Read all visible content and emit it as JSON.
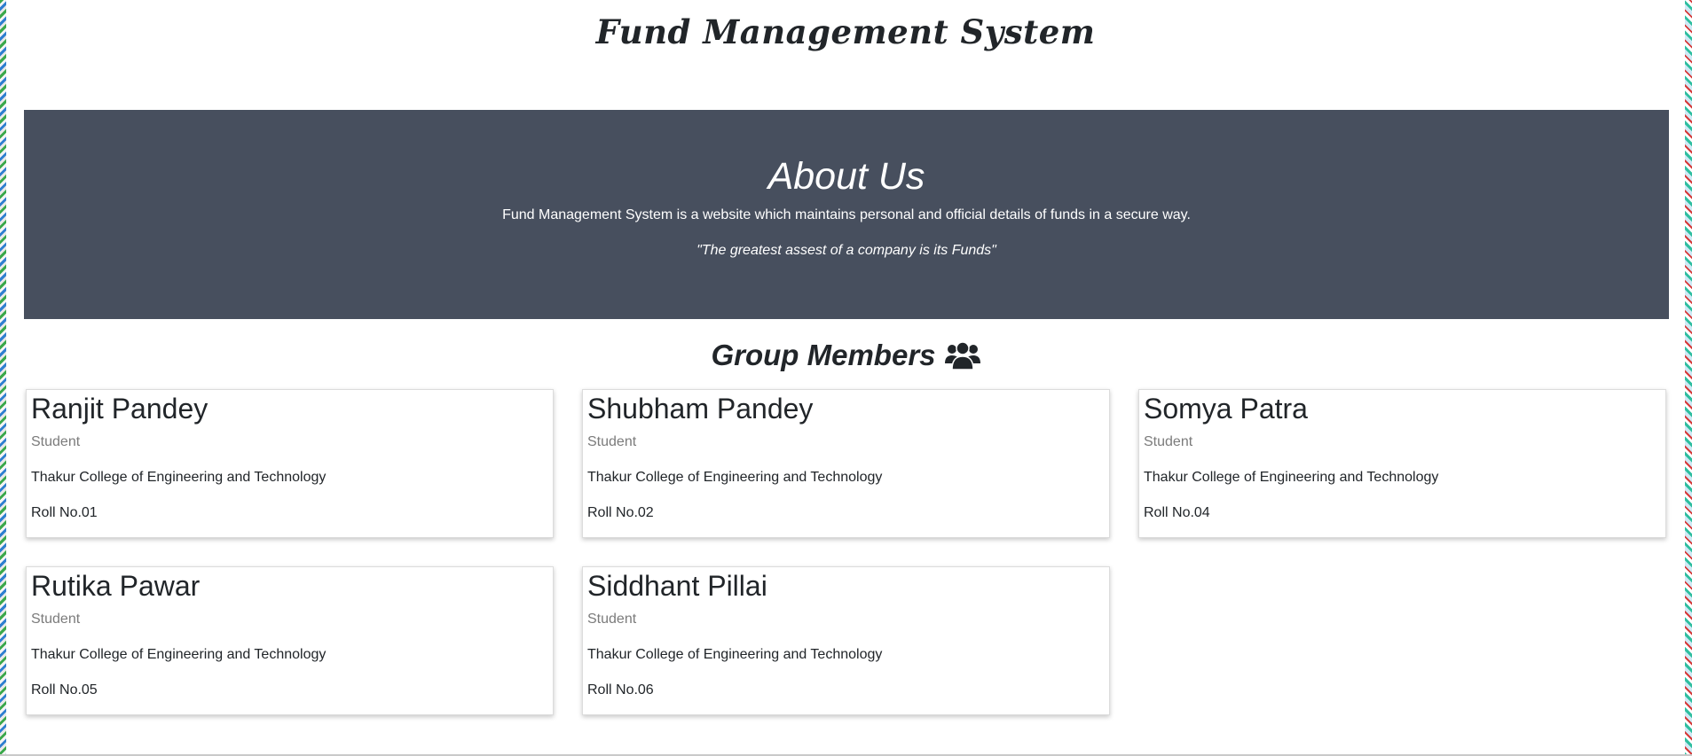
{
  "site": {
    "title": "Fund Management System"
  },
  "about": {
    "heading": "About Us",
    "description": "Fund Management System is a website which maintains personal and official details of funds in a secure way.",
    "quote": "\"The greatest assest of a company is its Funds\""
  },
  "members_section": {
    "heading": "Group Members",
    "icon": "group-users-icon"
  },
  "members": [
    {
      "name": "Ranjit Pandey",
      "role": "Student",
      "college": "Thakur College of Engineering and Technology",
      "roll": "Roll No.01"
    },
    {
      "name": "Shubham Pandey",
      "role": "Student",
      "college": "Thakur College of Engineering and Technology",
      "roll": "Roll No.02"
    },
    {
      "name": "Somya Patra",
      "role": "Student",
      "college": "Thakur College of Engineering and Technology",
      "roll": "Roll No.04"
    },
    {
      "name": "Rutika Pawar",
      "role": "Student",
      "college": "Thakur College of Engineering and Technology",
      "roll": "Roll No.05"
    },
    {
      "name": "Siddhant Pillai",
      "role": "Student",
      "college": "Thakur College of Engineering and Technology",
      "roll": "Roll No.06"
    }
  ],
  "colors": {
    "about_bg": "#474f5e",
    "text": "#212529",
    "muted": "#7b7b7b"
  }
}
